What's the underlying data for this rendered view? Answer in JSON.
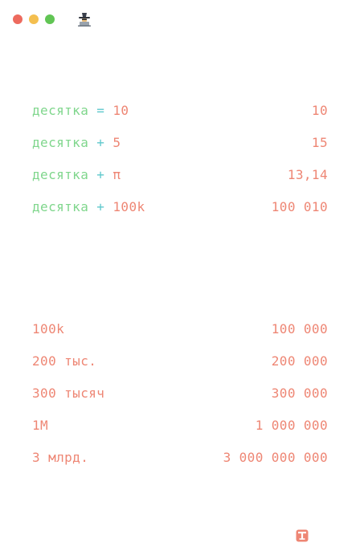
{
  "window": {
    "controls": {
      "close_color": "#ed6a5e",
      "minimize_color": "#f4bf4f",
      "maximize_color": "#61c554"
    },
    "app_icon": "hacker-hat-icon"
  },
  "colors": {
    "variable": "#7fd68c",
    "operator": "#5fc8cc",
    "number": "#ee8674",
    "result": "#ee8674"
  },
  "block1": [
    {
      "variable": "десятка",
      "operator": "=",
      "operand": "10",
      "result": "10"
    },
    {
      "variable": "десятка",
      "operator": "+",
      "operand": "5",
      "result": "15"
    },
    {
      "variable": "десятка",
      "operator": "+",
      "operand": "π",
      "result": "13,14"
    },
    {
      "variable": "десятка",
      "operator": "+",
      "operand": "100k",
      "result": "100 010"
    }
  ],
  "block2": [
    {
      "input": "100k",
      "result": "100 000"
    },
    {
      "input": "200 тыс.",
      "result": "200 000"
    },
    {
      "input": "300 тысяч",
      "result": "300 000"
    },
    {
      "input": "1M",
      "result": "1 000 000"
    },
    {
      "input": "3 млрд.",
      "result": "3 000 000 000"
    }
  ],
  "footer": {
    "icon": "text-format-icon"
  }
}
